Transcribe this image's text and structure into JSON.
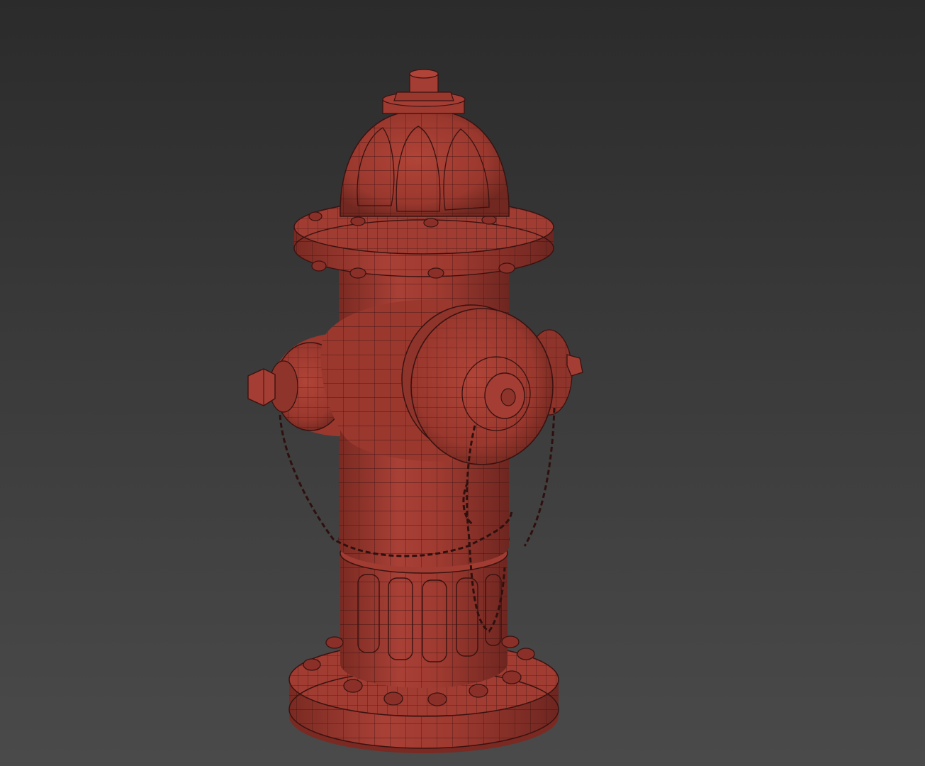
{
  "viewport": {
    "background_top": "#2b2b2b",
    "background_bottom": "#4a4a4a",
    "shading_mode": "wireframe-on-shaded"
  },
  "model": {
    "subject": "fire-hydrant",
    "base_color": "#9e3a30",
    "shadow_color": "#6e2620",
    "highlight_color": "#b8473b",
    "wire_color": "#3a1210",
    "parts": [
      "top-nut",
      "bonnet-dome",
      "bonnet-flange",
      "barrel-upper",
      "steamer-outlet",
      "side-outlet-left",
      "side-outlet-right",
      "chains",
      "barrel-lower",
      "base-flange",
      "bolts"
    ]
  }
}
